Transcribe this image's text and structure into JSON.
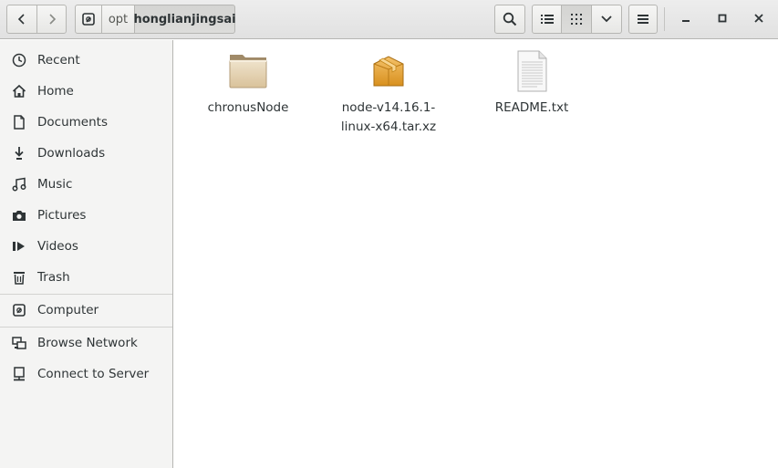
{
  "header": {
    "back_icon": "go-previous-icon",
    "forward_icon": "go-next-icon",
    "path": [
      "opt",
      "honglianjingsai"
    ],
    "search_icon": "search-icon",
    "view_list_icon": "view-list-icon",
    "view_grid_icon": "view-grid-icon",
    "view_options_icon": "chevron-down-icon",
    "menu_icon": "hamburger-menu-icon",
    "minimize_icon": "minimize-icon",
    "maximize_icon": "maximize-icon",
    "close_icon": "close-icon"
  },
  "sidebar": {
    "items": [
      {
        "label": "Recent",
        "icon": "clock-icon"
      },
      {
        "label": "Home",
        "icon": "home-icon"
      },
      {
        "label": "Documents",
        "icon": "document-icon"
      },
      {
        "label": "Downloads",
        "icon": "download-icon"
      },
      {
        "label": "Music",
        "icon": "music-icon"
      },
      {
        "label": "Pictures",
        "icon": "camera-icon"
      },
      {
        "label": "Videos",
        "icon": "video-icon"
      },
      {
        "label": "Trash",
        "icon": "trash-icon"
      },
      {
        "label": "Computer",
        "icon": "drive-icon"
      },
      {
        "label": "Browse Network",
        "icon": "network-icon"
      },
      {
        "label": "Connect to Server",
        "icon": "server-icon"
      }
    ]
  },
  "files": [
    {
      "name": "chronusNode",
      "type": "folder"
    },
    {
      "name": "node-v14.16.1-linux-x64.tar.xz",
      "name_line1": "node-v14.16.1-",
      "name_line2": "linux-x64.tar.xz",
      "type": "archive"
    },
    {
      "name": "README.txt",
      "type": "text"
    }
  ]
}
